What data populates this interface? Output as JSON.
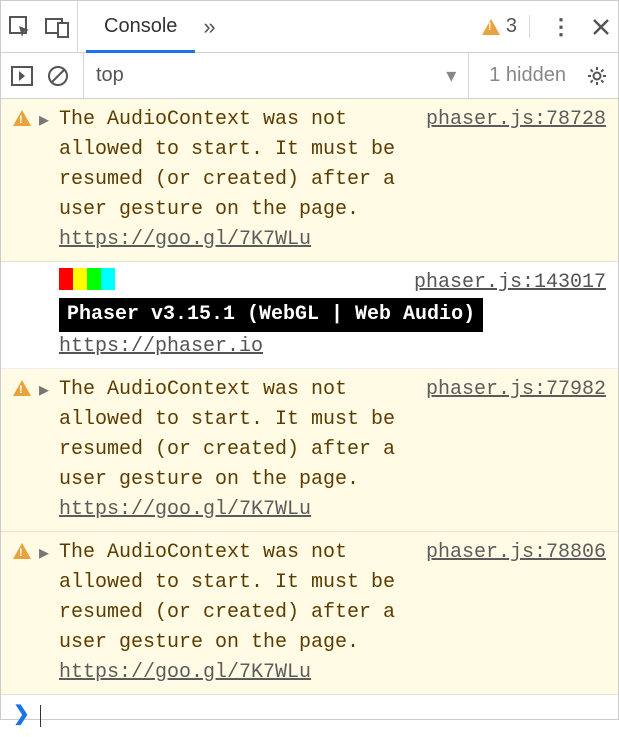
{
  "topbar": {
    "tab_label": "Console",
    "warning_count": "3"
  },
  "filter": {
    "context": "top",
    "hidden_label": "1 hidden"
  },
  "messages": [
    {
      "type": "warning",
      "text": "The AudioContext was not allowed to start. It must be resumed (or created) after a user gesture on the page.",
      "link_text": "https://goo.gl/7K7WLu",
      "source": "phaser.js:78728"
    },
    {
      "type": "log-phaser",
      "version_text": "Phaser v3.15.1 (WebGL | Web Audio)",
      "site_link": "https://phaser.io",
      "source": "phaser.js:143017",
      "colors": [
        "#ff0000",
        "#ffff00",
        "#00ff00",
        "#00ffff"
      ]
    },
    {
      "type": "warning",
      "text": "The AudioContext was not allowed to start. It must be resumed (or created) after a user gesture on the page.",
      "link_text": "https://goo.gl/7K7WLu",
      "source": "phaser.js:77982"
    },
    {
      "type": "warning",
      "text": "The AudioContext was not allowed to start. It must be resumed (or created) after a user gesture on the page.",
      "link_text": "https://goo.gl/7K7WLu",
      "source": "phaser.js:78806"
    }
  ],
  "prompt": {
    "symbol": "❯"
  }
}
